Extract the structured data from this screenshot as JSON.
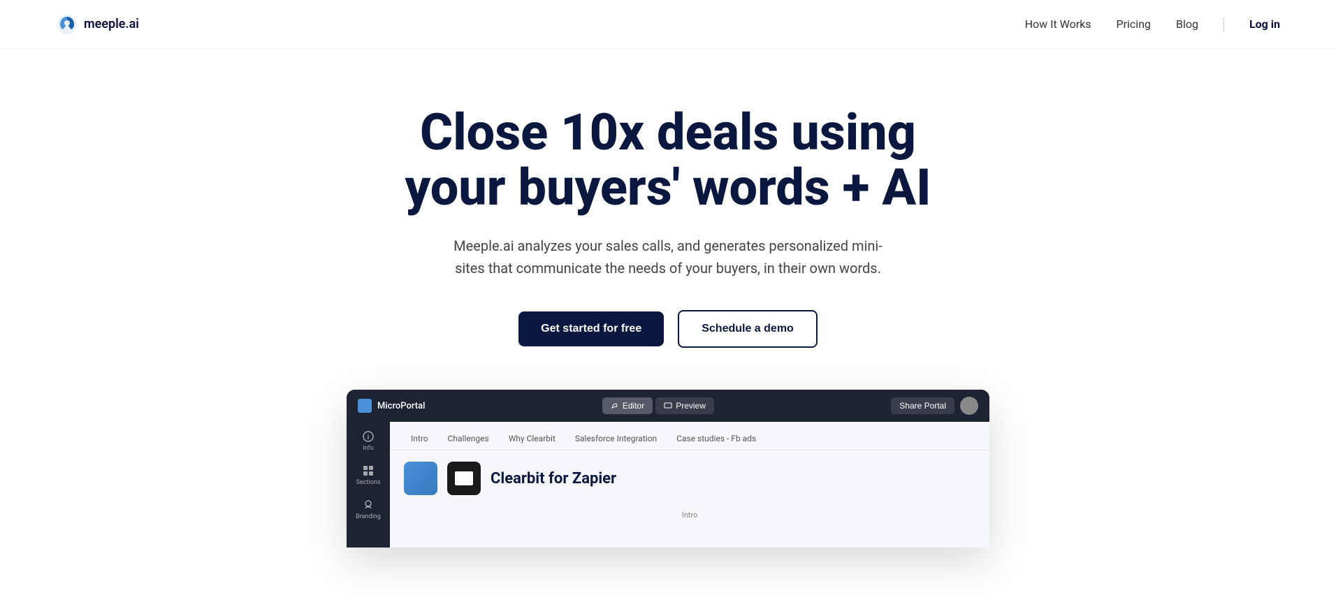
{
  "nav": {
    "logo_text": "meeple.ai",
    "links": [
      {
        "label": "How It Works",
        "id": "how-it-works"
      },
      {
        "label": "Pricing",
        "id": "pricing"
      },
      {
        "label": "Blog",
        "id": "blog"
      }
    ],
    "login_label": "Log in"
  },
  "hero": {
    "title_line1": "Close 10x deals using",
    "title_line2": "your buyers' words + AI",
    "subtitle": "Meeple.ai analyzes your sales calls, and generates personalized mini-sites that communicate the needs of your buyers, in their own words.",
    "cta_primary": "Get started for free",
    "cta_secondary": "Schedule a demo"
  },
  "preview": {
    "window_title": "MicroPortal",
    "tab_editor": "Editor",
    "tab_preview": "Preview",
    "share_button": "Share Portal",
    "tabs": [
      {
        "label": "Intro",
        "active": false
      },
      {
        "label": "Challenges",
        "active": false
      },
      {
        "label": "Why Clearbit",
        "active": false
      },
      {
        "label": "Salesforce Integration",
        "active": false
      },
      {
        "label": "Case studies - Fb ads",
        "active": false
      }
    ],
    "app_title": "Clearbit for Zapier",
    "section_label": "Intro",
    "sidebar_items": [
      {
        "label": "Info"
      },
      {
        "label": "Sections"
      },
      {
        "label": "Branding"
      }
    ]
  },
  "colors": {
    "nav_bg": "#ffffff",
    "hero_title": "#0a1840",
    "btn_primary_bg": "#0a1840",
    "btn_primary_text": "#ffffff",
    "btn_secondary_bg": "#ffffff",
    "btn_secondary_border": "#0a1840"
  }
}
